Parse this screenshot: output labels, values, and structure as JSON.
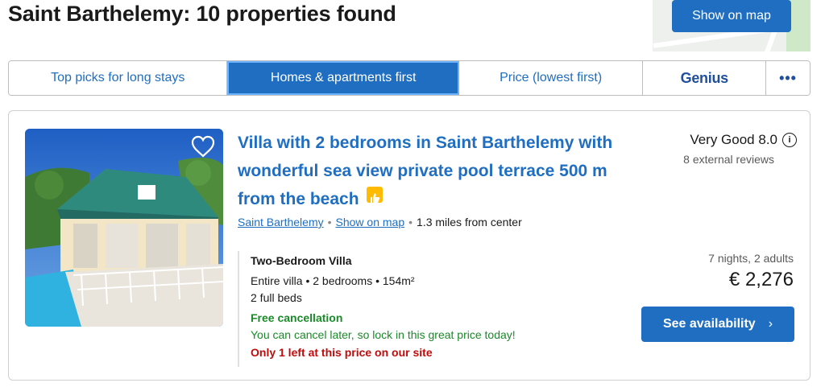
{
  "header": {
    "title": "Saint Barthelemy: 10 properties found",
    "map_button": "Show on map"
  },
  "sort_tabs": [
    {
      "label": "Top picks for long stays",
      "active": false
    },
    {
      "label": "Homes & apartments first",
      "active": true
    },
    {
      "label": "Price (lowest first)",
      "active": false
    },
    {
      "label": "Genius",
      "active": false
    },
    {
      "label": "•••",
      "active": false
    }
  ],
  "property": {
    "title": "Villa with 2 bedrooms in Saint Barthelemy with wonderful sea view private pool terrace 500 m from the beach",
    "location_link": "Saint Barthelemy",
    "map_link": "Show on map",
    "distance": "1.3 miles from center",
    "rating_text": "Very Good 8.0",
    "review_count": "8 external reviews",
    "room_name": "Two-Bedroom Villa",
    "room_desc": "Entire villa • 2 bedrooms • 154m²",
    "beds": "2 full beds",
    "free_cancellation": "Free cancellation",
    "cancel_note": "You can cancel later, so lock in this great price today!",
    "scarcity": "Only 1 left at this price on our site",
    "stay_info": "7 nights, 2 adults",
    "price": "€ 2,276",
    "cta": "See availability"
  },
  "icons": {
    "heart": "heart-icon",
    "info": "info-icon",
    "thumb": "thumbs-up-icon",
    "chevron": "chevron-right-icon"
  },
  "colors": {
    "brand_blue": "#1f6ec2",
    "green": "#1a8a28",
    "red": "#c00b0b",
    "yellow": "#febb02"
  }
}
